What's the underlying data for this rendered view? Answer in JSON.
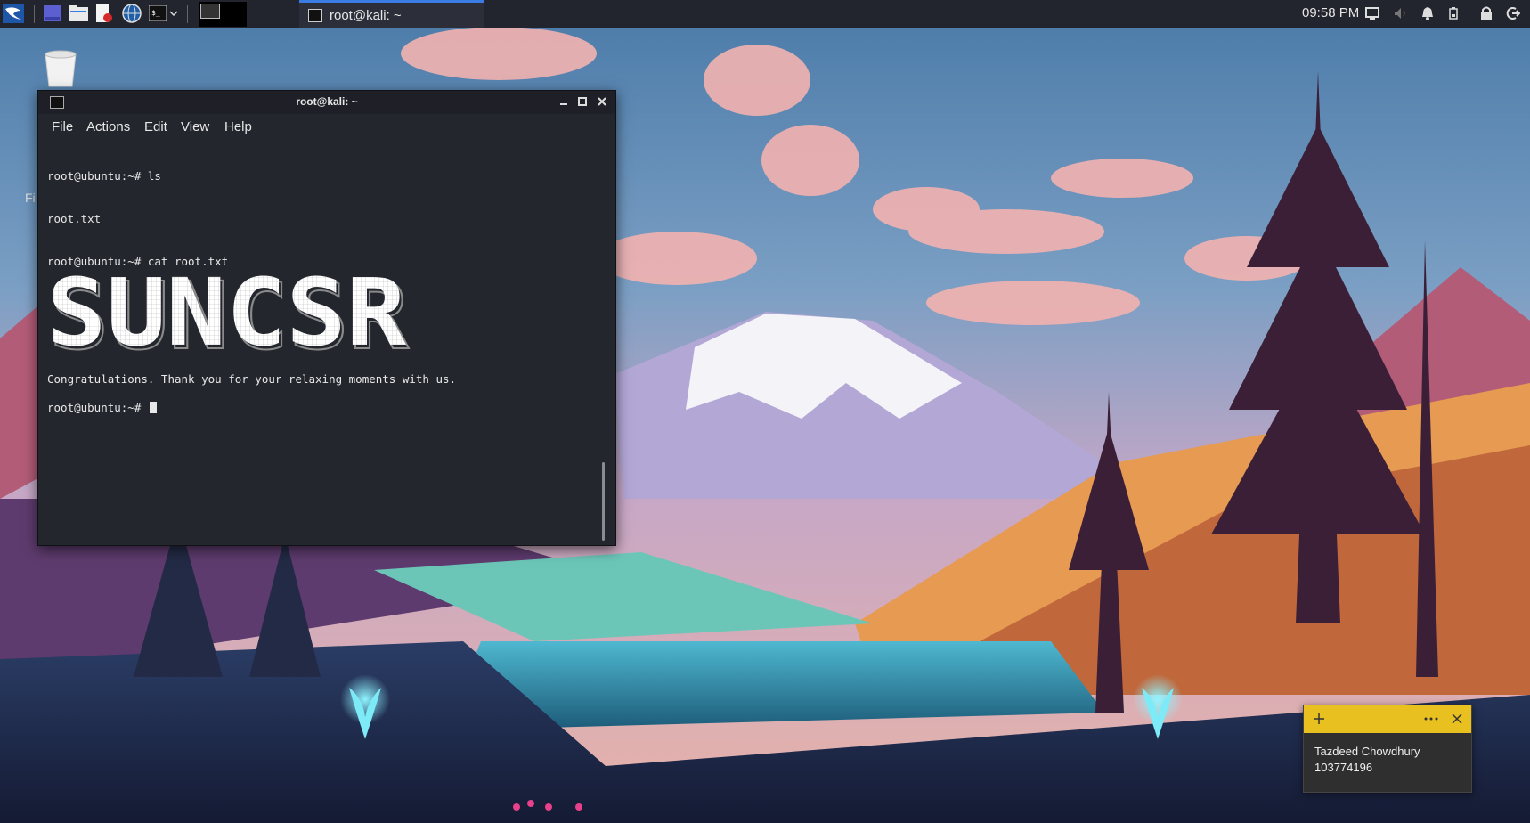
{
  "panel": {
    "launchers": [
      {
        "name": "kali-menu-icon"
      },
      {
        "name": "workspace-desktop-icon"
      },
      {
        "name": "file-manager-icon"
      },
      {
        "name": "text-editor-icon"
      },
      {
        "name": "web-browser-icon"
      },
      {
        "name": "terminal-icon"
      }
    ],
    "task_title": "root@kali: ~",
    "clock": "09:58 PM",
    "tray_icons": [
      "display-icon",
      "volume-icon",
      "notification-bell-icon",
      "battery-icon",
      "lock-icon",
      "logout-icon"
    ]
  },
  "terminal": {
    "window_title": "root@kali: ~",
    "menu": [
      "File",
      "Actions",
      "Edit",
      "View",
      "Help"
    ],
    "lines": [
      "root@ubuntu:~# ls",
      "root.txt",
      "root@ubuntu:~# cat root.txt"
    ],
    "banner_text": "SUNCSR",
    "congrats": "Congratulations. Thank you for your relaxing moments with us.",
    "prompt": "root@ubuntu:~# "
  },
  "desktop": {
    "partial_label": "Fi"
  },
  "sticky_note": {
    "name": "Tazdeed Chowdhury",
    "id": "103774196"
  },
  "colors": {
    "panel_bg": "#23252e",
    "terminal_bg": "#24262e",
    "task_accent": "#3a7be6",
    "note_bar": "#e8c020"
  }
}
